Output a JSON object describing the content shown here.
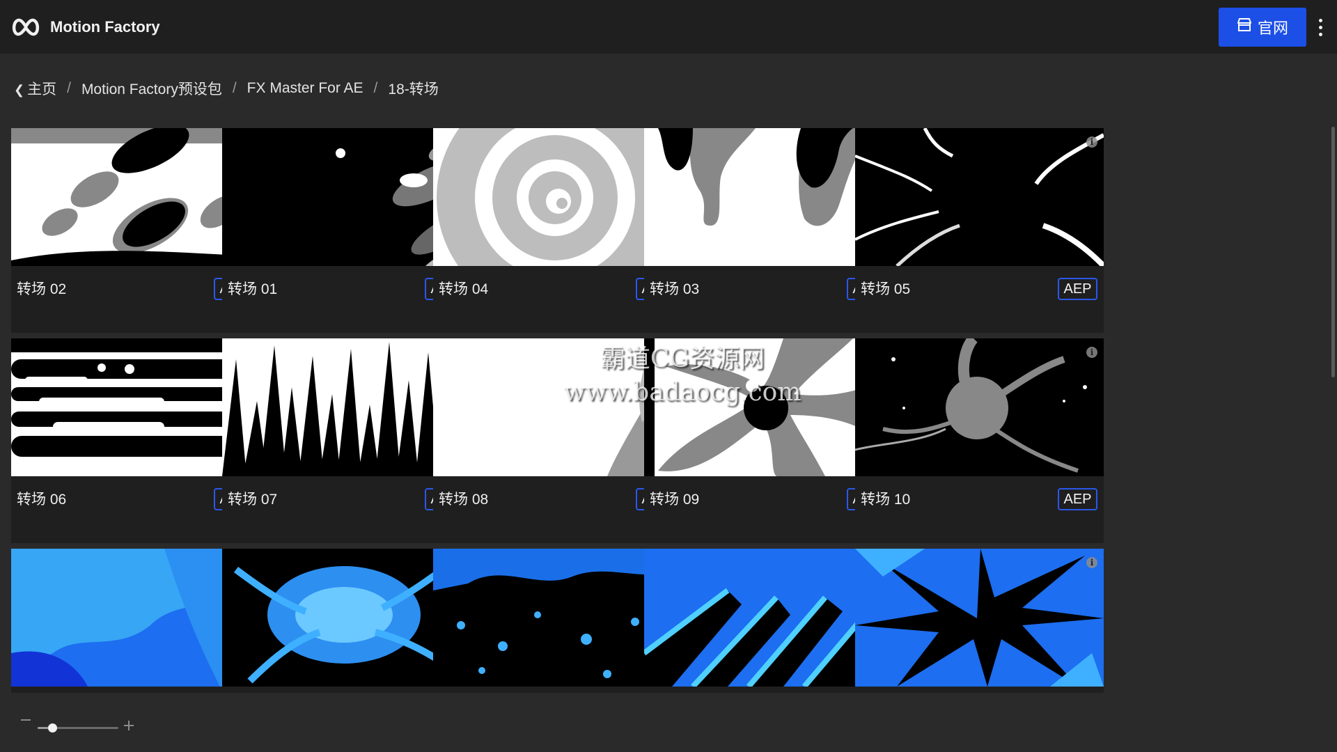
{
  "header": {
    "app_title": "Motion Factory",
    "logo_icon": "motion-factory-logo",
    "official_button": {
      "label": "官网",
      "icon": "store-icon",
      "color": "#1c4fe6"
    },
    "more_icon": "more-vertical-icon"
  },
  "breadcrumb": {
    "back_icon": "chevron-left-icon",
    "items": [
      "主页",
      "Motion Factory预设包",
      "FX Master For AE",
      "18-转场"
    ],
    "separator": "/"
  },
  "cards": [
    {
      "name": "转场 02",
      "badge": "AEP",
      "thumb": "t02"
    },
    {
      "name": "转场 01",
      "badge": "AEP",
      "thumb": "t01"
    },
    {
      "name": "转场 04",
      "badge": "AEP",
      "thumb": "t04"
    },
    {
      "name": "转场 03",
      "badge": "AEP",
      "thumb": "t03"
    },
    {
      "name": "转场 05",
      "badge": "AEP",
      "thumb": "t05"
    },
    {
      "name": "转场 06",
      "badge": "AEP",
      "thumb": "t06"
    },
    {
      "name": "转场 07",
      "badge": "AEP",
      "thumb": "t07"
    },
    {
      "name": "转场 08",
      "badge": "AEP",
      "thumb": "t08"
    },
    {
      "name": "转场 09",
      "badge": "AEP",
      "thumb": "t09"
    },
    {
      "name": "转场 10",
      "badge": "AEP",
      "thumb": "t10"
    },
    {
      "name": "",
      "badge": "",
      "thumb": "b1"
    },
    {
      "name": "",
      "badge": "",
      "thumb": "b2"
    },
    {
      "name": "",
      "badge": "",
      "thumb": "b3"
    },
    {
      "name": "",
      "badge": "",
      "thumb": "b4"
    },
    {
      "name": "",
      "badge": "",
      "thumb": "b5"
    }
  ],
  "info_icon": "info-icon",
  "watermark": {
    "line1": "霸道CG资源网",
    "line2": "www.badaocg.com"
  },
  "zoom": {
    "minus_icon": "minus-icon",
    "plus_icon": "plus-icon",
    "level": 0.18
  },
  "colors": {
    "accent": "#1c4fe6",
    "badge_border": "#2a58ea",
    "background": "#2a2a2b",
    "card": "#1f1f20"
  }
}
